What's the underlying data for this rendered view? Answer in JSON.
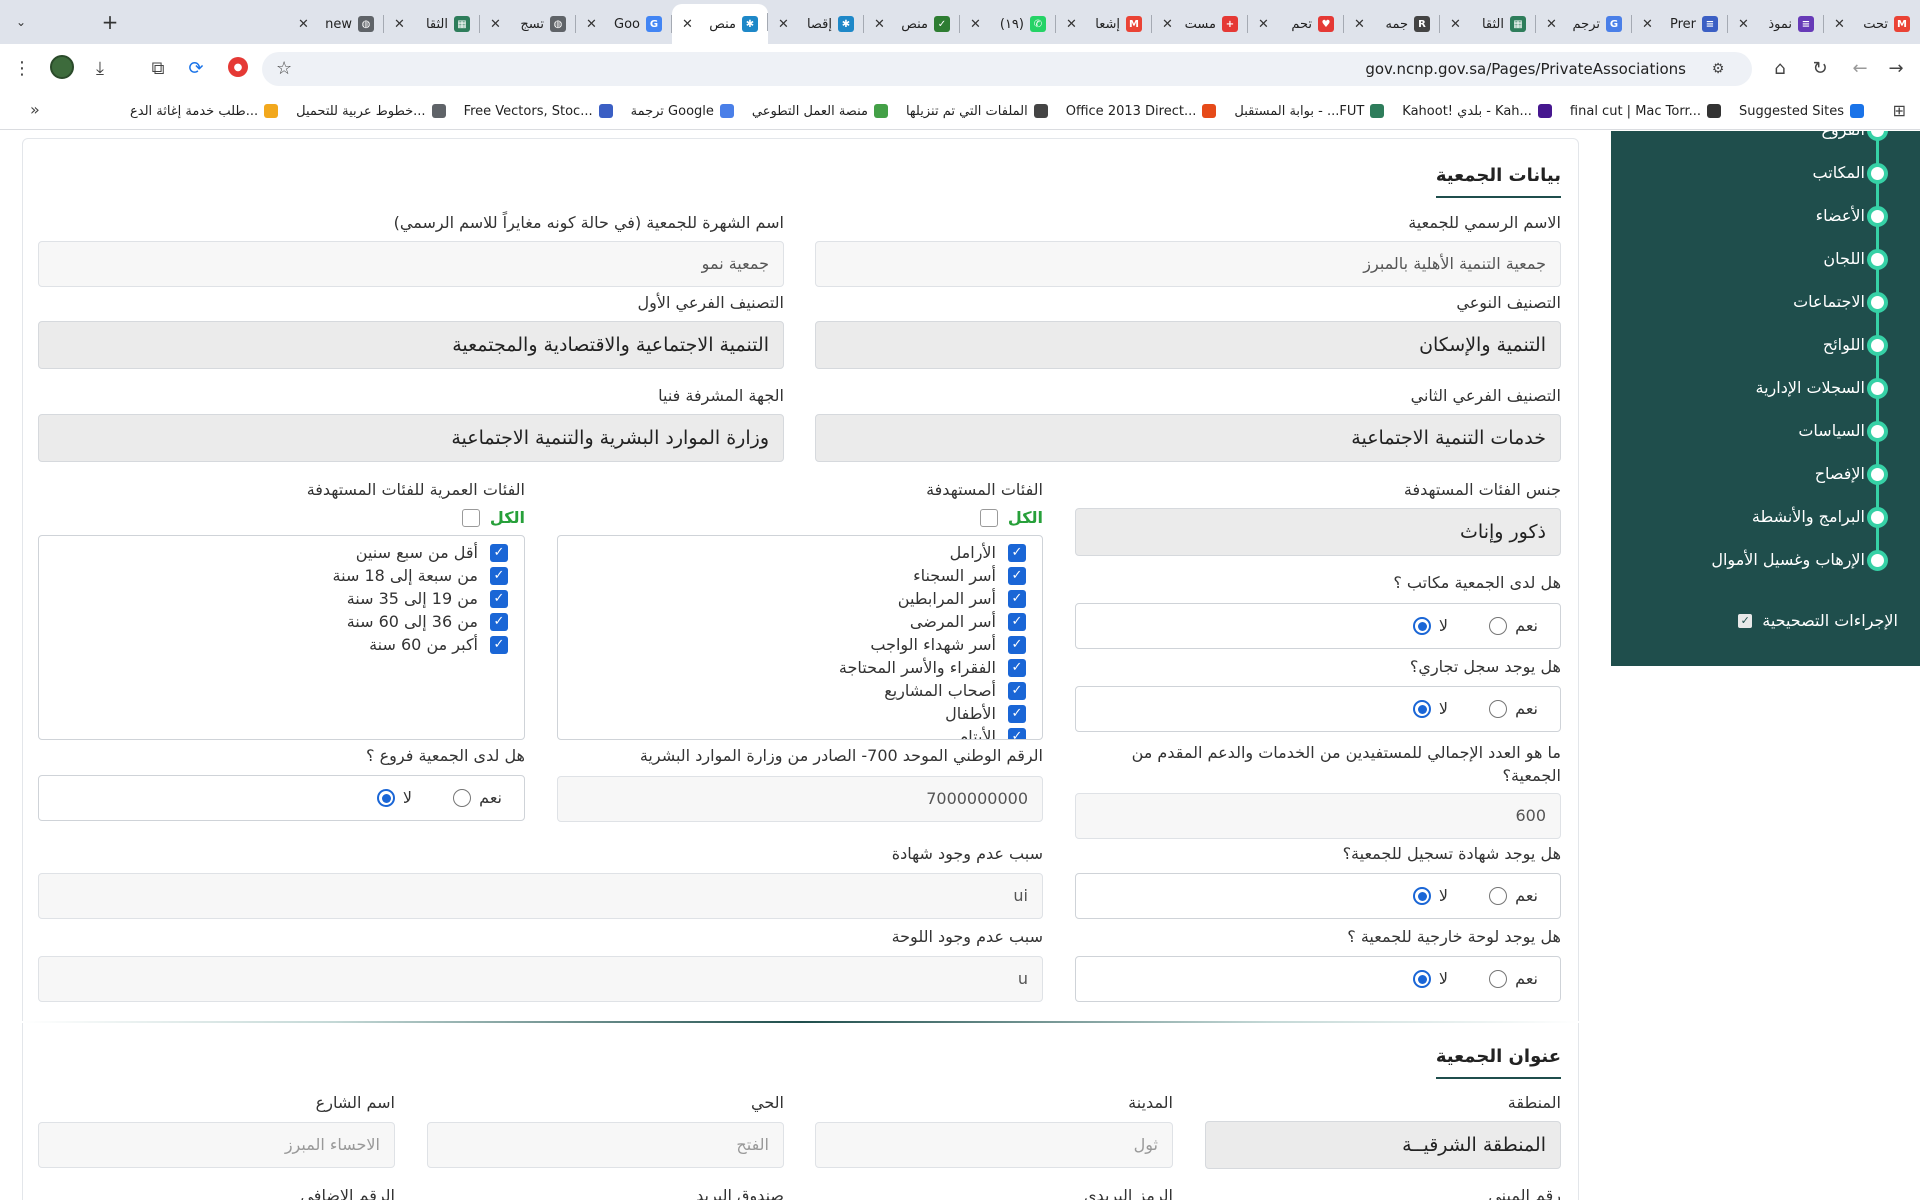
{
  "browser": {
    "tabs": [
      {
        "title": "تحت",
        "fav": "gmail",
        "color": "#ea4335"
      },
      {
        "title": "نموذ",
        "fav": "forms",
        "color": "#673ab7"
      },
      {
        "title": "Prer",
        "fav": "docs",
        "color": "#3b5fc4"
      },
      {
        "title": "ترجم",
        "fav": "translate",
        "color": "#4a7fe8"
      },
      {
        "title": "الثقا",
        "fav": "ministry",
        "color": "#2e7d5b"
      },
      {
        "title": "جمه",
        "fav": "r",
        "color": "#444444"
      },
      {
        "title": "تحم",
        "fav": "heart",
        "color": "#e53935"
      },
      {
        "title": "مست",
        "fav": "plus",
        "color": "#e53935"
      },
      {
        "title": "إشعا",
        "fav": "gmail",
        "color": "#ea4335"
      },
      {
        "title": "(١٩)",
        "fav": "whatsapp",
        "color": "#25d366"
      },
      {
        "title": "منص",
        "fav": "check",
        "color": "#2e7d32"
      },
      {
        "title": "إقصا",
        "fav": "ncnp",
        "color": "#1e88c8"
      },
      {
        "title": "منص",
        "fav": "ncnp",
        "color": "#1e88c8",
        "active": true
      },
      {
        "title": "Goo",
        "fav": "google",
        "color": "#4285f4"
      },
      {
        "title": "تسج",
        "fav": "globe",
        "color": "#5f6368"
      },
      {
        "title": "الثقا",
        "fav": "ministry",
        "color": "#2e7d5b"
      },
      {
        "title": "new",
        "fav": "globe",
        "color": "#5f6368"
      }
    ],
    "url": "gov.ncnp.gov.sa/Pages/PrivateAssociations",
    "bookmarks": [
      {
        "label": "Suggested Sites",
        "color": "#1a73e8"
      },
      {
        "label": "final cut | Mac Torr...",
        "color": "#333333"
      },
      {
        "label": "Kahoot! بلدي - Kah...",
        "color": "#46178f"
      },
      {
        "label": "بوابة المستقبل - ...FUT",
        "color": "#2e7d5b"
      },
      {
        "label": "Office 2013 Direct...",
        "color": "#e64a19"
      },
      {
        "label": "الملفات التي تم تنزيلها",
        "color": "#444444"
      },
      {
        "label": "منصة العمل التطوعي",
        "color": "#43a047"
      },
      {
        "label": "ترجمة Google",
        "color": "#4a7fe8"
      },
      {
        "label": "Free Vectors, Stoc...",
        "color": "#3b5fc4"
      },
      {
        "label": "خطوط عربية للتحميل...",
        "color": "#5f6368"
      },
      {
        "label": "طلب خدمة إغاثة الدع...",
        "color": "#f2a81d"
      }
    ]
  },
  "sidebar": {
    "items": [
      "الفروع",
      "المكاتب",
      "الأعضاء",
      "اللجان",
      "الاجتماعات",
      "اللوائح",
      "السجلات الإدارية",
      "السياسات",
      "الإفصاح",
      "البرامج والأنشطة",
      "الإرهاب وغسيل الأموال"
    ],
    "last_item": "الإجراءات التصحيحية"
  },
  "assoc": {
    "section_title": "بيانات الجمعية",
    "official_name": {
      "label": "الاسم الرسمي للجمعية",
      "value": "جمعية التنمية الأهلية بالمبرز"
    },
    "popular_name": {
      "label": "اسم الشهرة للجمعية (في حالة كونه مغايراً للاسم الرسمي)",
      "value": "جمعية نمو"
    },
    "type_class": {
      "label": "التصنيف النوعي",
      "value": "التنمية والإسكان"
    },
    "sub_class_1": {
      "label": "التصنيف الفرعي الأول",
      "value": "التنمية الاجتماعية والاقتصادية والمجتمعية"
    },
    "sub_class_2": {
      "label": "التصنيف الفرعي الثاني",
      "value": "خدمات التنمية الاجتماعية"
    },
    "supervisor": {
      "label": "الجهة المشرفة فنيا",
      "value": "وزارة الموارد البشرية والتنمية الاجتماعية"
    },
    "gender": {
      "label": "جنس الفئات المستهدفة",
      "value": "ذكور وإناث"
    },
    "target_groups": {
      "label": "الفئات المستهدفة",
      "all_label": "الكل",
      "items": [
        "الأرامل",
        "أسر السجناء",
        "أسر المرابطين",
        "أسر المرضى",
        "أسر شهداء الواجب",
        "الفقراء والأسر المحتاجة",
        "أصحاب المشاريع",
        "الأطفال",
        "الأيتام"
      ]
    },
    "age_groups": {
      "label": "الفئات العمرية للفئات المستهدفة",
      "all_label": "الكل",
      "items": [
        "أقل من سبع سنين",
        "من سبعة إلى 18 سنة",
        "من 19 إلى 35 سنة",
        "من 36 إلى 60 سنة",
        "أكبر من 60 سنة"
      ]
    },
    "yes_label": "نعم",
    "no_label": "لا",
    "has_offices": "هل لدى الجمعية مكاتب ؟",
    "has_commercial": "هل يوجد سجل تجاري؟",
    "beneficiaries": {
      "label": "ما هو العدد الإجمالي للمستفيدين من الخدمات والدعم المقدم من الجمعية؟",
      "value": "600"
    },
    "has_branches": "هل لدى الجمعية فروع ؟",
    "national_number": {
      "label": "الرقم الوطني الموحد 700- الصادر من وزارة الموارد البشرية",
      "value": "7000000000"
    },
    "has_certificate": "هل يوجد شهادة تسجيل للجمعية؟",
    "no_certificate_reason": {
      "label": "سبب عدم وجود شهادة",
      "value": "ui"
    },
    "has_sign": "هل يوجد لوحة خارجية للجمعية ؟",
    "no_sign_reason": {
      "label": "سبب عدم وجود اللوحة",
      "value": "u"
    }
  },
  "address": {
    "section_title": "عنوان الجمعية",
    "region": {
      "label": "المنطقة",
      "value": "المنطقة الشرقيــة"
    },
    "city": {
      "label": "المدينة",
      "placeholder": "ثول"
    },
    "district": {
      "label": "الحي",
      "placeholder": "الفتح"
    },
    "street": {
      "label": "اسم الشارع",
      "placeholder": "الاحساء المبرز"
    },
    "building_no": {
      "label": "رقم المبنى"
    },
    "postal_code": {
      "label": "الرمز البريدي"
    },
    "po_box": {
      "label": "صندوق البريد"
    },
    "additional_no": {
      "label": "الرقم الإضافي"
    }
  }
}
